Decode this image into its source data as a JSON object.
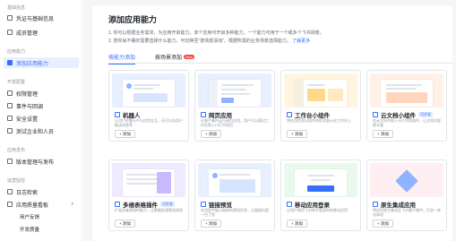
{
  "sidebar": {
    "groups": [
      "基础信息",
      "应用能力",
      "开发配置",
      "应用发布",
      "运营监控"
    ],
    "items": [
      {
        "label": "凭证与基础信息",
        "active": false
      },
      {
        "label": "成员管理",
        "active": false
      },
      {
        "label": "添加应用能力",
        "active": true
      },
      {
        "label": "权限管理",
        "active": false
      },
      {
        "label": "事件与回调",
        "active": false
      },
      {
        "label": "安全设置",
        "active": false
      },
      {
        "label": "测试企业和人员",
        "active": false
      },
      {
        "label": "版本管理与发布",
        "active": false
      },
      {
        "label": "日志检索",
        "active": false
      },
      {
        "label": "应用质量看板",
        "active": false
      }
    ],
    "sub_items": [
      "用户反馈",
      "开发质量"
    ]
  },
  "main": {
    "title": "添加应用能力",
    "desc_line1": "1. 你可以根据业务需求，为应用开启能力。单个应用可开启多种能力，一个能力可用于一个或多个飞书场景。",
    "desc_line2": "2. 若你尚不确定需要选择什么能力，可切换至“按场景添加”，根据所需的业务场景选择能力。",
    "desc_link": "了解更多",
    "tabs": [
      {
        "label": "按能力添加",
        "active": true
      },
      {
        "label": "按场景添加",
        "badge": "New"
      }
    ],
    "add_label": "+ 添加",
    "cards": [
      {
        "title": "机器人",
        "desc": "让用户在聊天中与应用交互，还可以向用户推送消息等",
        "thumb": "#e8f0ff",
        "tag": ""
      },
      {
        "title": "网页应用",
        "desc": "在客户端内运行网页应用，用户可以通过工作台等入口打开网页",
        "thumb": "#e8f0ff",
        "tag": ""
      },
      {
        "title": "工作台小组件",
        "desc": "将应用信息以组件的形式展示在工作台上",
        "thumb": "#fff5e0",
        "tag": ""
      },
      {
        "title": "云文档小组件",
        "desc": "在云文档中插入卡片式的组件，让文档内容更丰富",
        "thumb": "#fff1e8",
        "tag": "可开发"
      },
      {
        "title": "多维表格插件",
        "desc": "扩展多维表格的能力，让数据处理更加高效",
        "thumb": "#efeaff",
        "tag": "可开发"
      },
      {
        "title": "链接预览",
        "desc": "在消息中展示链接的预览信息，让链接内容一目了然",
        "thumb": "#e8f0ff",
        "tag": ""
      },
      {
        "title": "移动应用登录",
        "desc": "让用户使用飞书账号登录你的移动应用",
        "thumb": "#e9f9ee",
        "tag": ""
      },
      {
        "title": "原生集成应用",
        "desc": "将应用原生集成至飞书客户端中，打造一体化体验",
        "thumb": "#ffeef2",
        "tag": ""
      }
    ]
  },
  "colors": {
    "accent": "#3370ff",
    "badge": "#f54a45",
    "sidebar_active_bg": "#e8efff"
  }
}
